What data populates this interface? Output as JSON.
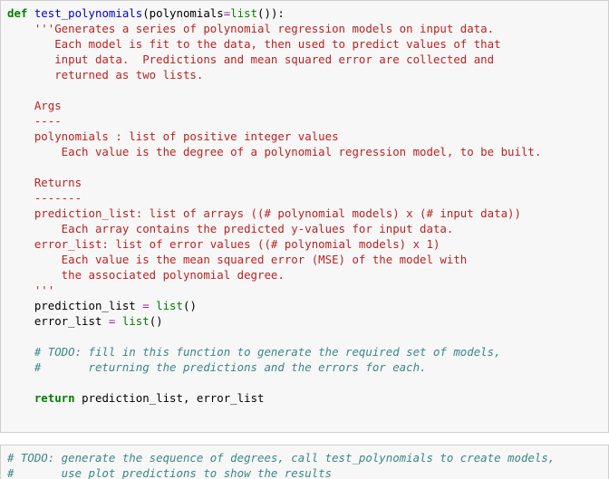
{
  "app": {
    "kind": "jupyter-notebook",
    "cell_bg": "#f7f7f7",
    "cell_border": "#cfcfcf",
    "page_bg": "#ffffff"
  },
  "colors": {
    "keyword": "#007f00",
    "function_name": "#0000d0",
    "builtin": "#007f00",
    "operator": "#a025a0",
    "string": "#bb2222",
    "comment": "#3b8686",
    "plain": "#000000"
  },
  "cells": [
    {
      "name": "code-cell-test-polynomials",
      "type": "code",
      "source": "def test_polynomials(polynomials=list()):\n    '''Generates a series of polynomial regression models on input data.\n       Each model is fit to the data, then used to predict values of that\n       input data.  Predictions and mean squared error are collected and\n       returned as two lists.\n\n    Args\n    ----\n    polynomials : list of positive integer values\n        Each value is the degree of a polynomial regression model, to be built.\n\n    Returns\n    -------\n    prediction_list: list of arrays ((# polynomial models) x (# input data))\n        Each array contains the predicted y-values for input data.\n    error_list: list of error values ((# polynomial models) x 1)\n        Each value is the mean squared error (MSE) of the model with\n        the associated polynomial degree.\n    '''\n    prediction_list = list()\n    error_list = list()\n\n    # TODO: fill in this function to generate the required set of models,\n    #       returning the predictions and the errors for each.\n\n    return prediction_list, error_list",
      "lines": [
        {
          "tokens": [
            {
              "t": "def ",
              "c": "kw"
            },
            {
              "t": "test_polynomials",
              "c": "fn"
            },
            {
              "t": "(polynomials",
              "c": "pl"
            },
            {
              "t": "=",
              "c": "op"
            },
            {
              "t": "list",
              "c": "bi"
            },
            {
              "t": "()):",
              "c": "pl"
            }
          ]
        },
        {
          "tokens": [
            {
              "t": "    '''Generates a series of polynomial regression models on input data.",
              "c": "str"
            }
          ]
        },
        {
          "tokens": [
            {
              "t": "       Each model is fit to the data, then used to predict values of that",
              "c": "str"
            }
          ]
        },
        {
          "tokens": [
            {
              "t": "       input data.  Predictions and mean squared error are collected and",
              "c": "str"
            }
          ]
        },
        {
          "tokens": [
            {
              "t": "       returned as two lists.",
              "c": "str"
            }
          ]
        },
        {
          "tokens": [
            {
              "t": "",
              "c": "str"
            }
          ]
        },
        {
          "tokens": [
            {
              "t": "    Args",
              "c": "str"
            }
          ]
        },
        {
          "tokens": [
            {
              "t": "    ----",
              "c": "str"
            }
          ]
        },
        {
          "tokens": [
            {
              "t": "    polynomials : list of positive integer values",
              "c": "str"
            }
          ]
        },
        {
          "tokens": [
            {
              "t": "        Each value is the degree of a polynomial regression model, to be built.",
              "c": "str"
            }
          ]
        },
        {
          "tokens": [
            {
              "t": "",
              "c": "str"
            }
          ]
        },
        {
          "tokens": [
            {
              "t": "    Returns",
              "c": "str"
            }
          ]
        },
        {
          "tokens": [
            {
              "t": "    -------",
              "c": "str"
            }
          ]
        },
        {
          "tokens": [
            {
              "t": "    prediction_list: list of arrays ((# polynomial models) x (# input data))",
              "c": "str"
            }
          ]
        },
        {
          "tokens": [
            {
              "t": "        Each array contains the predicted y-values for input data.",
              "c": "str"
            }
          ]
        },
        {
          "tokens": [
            {
              "t": "    error_list: list of error values ((# polynomial models) x 1)",
              "c": "str"
            }
          ]
        },
        {
          "tokens": [
            {
              "t": "        Each value is the mean squared error (MSE) of the model with",
              "c": "str"
            }
          ]
        },
        {
          "tokens": [
            {
              "t": "        the associated polynomial degree.",
              "c": "str"
            }
          ]
        },
        {
          "tokens": [
            {
              "t": "    '''",
              "c": "str"
            }
          ]
        },
        {
          "tokens": [
            {
              "t": "    prediction_list ",
              "c": "pl"
            },
            {
              "t": "=",
              "c": "op"
            },
            {
              "t": " ",
              "c": "pl"
            },
            {
              "t": "list",
              "c": "bi"
            },
            {
              "t": "()",
              "c": "pl"
            }
          ]
        },
        {
          "tokens": [
            {
              "t": "    error_list ",
              "c": "pl"
            },
            {
              "t": "=",
              "c": "op"
            },
            {
              "t": " ",
              "c": "pl"
            },
            {
              "t": "list",
              "c": "bi"
            },
            {
              "t": "()",
              "c": "pl"
            }
          ]
        },
        {
          "tokens": [
            {
              "t": "",
              "c": "pl"
            }
          ]
        },
        {
          "tokens": [
            {
              "t": "    # TODO: fill in this function to generate the required set of models,",
              "c": "cm"
            }
          ]
        },
        {
          "tokens": [
            {
              "t": "    #       returning the predictions and the errors for each.",
              "c": "cm"
            }
          ]
        },
        {
          "tokens": [
            {
              "t": "",
              "c": "pl"
            }
          ]
        },
        {
          "tokens": [
            {
              "t": "    return",
              "c": "kw"
            },
            {
              "t": " prediction_list, error_list",
              "c": "pl"
            }
          ]
        }
      ]
    },
    {
      "name": "code-cell-todo-driver",
      "type": "code",
      "source": "# TODO: generate the sequence of degrees, call test_polynomials to create models,\n#       use plot_predictions to show the results",
      "lines": [
        {
          "tokens": [
            {
              "t": "# TODO: generate the sequence of degrees, call test_polynomials to create models,",
              "c": "cm"
            }
          ]
        },
        {
          "tokens": [
            {
              "t": "#       use plot_predictions to show the results",
              "c": "cm"
            }
          ]
        }
      ]
    }
  ]
}
